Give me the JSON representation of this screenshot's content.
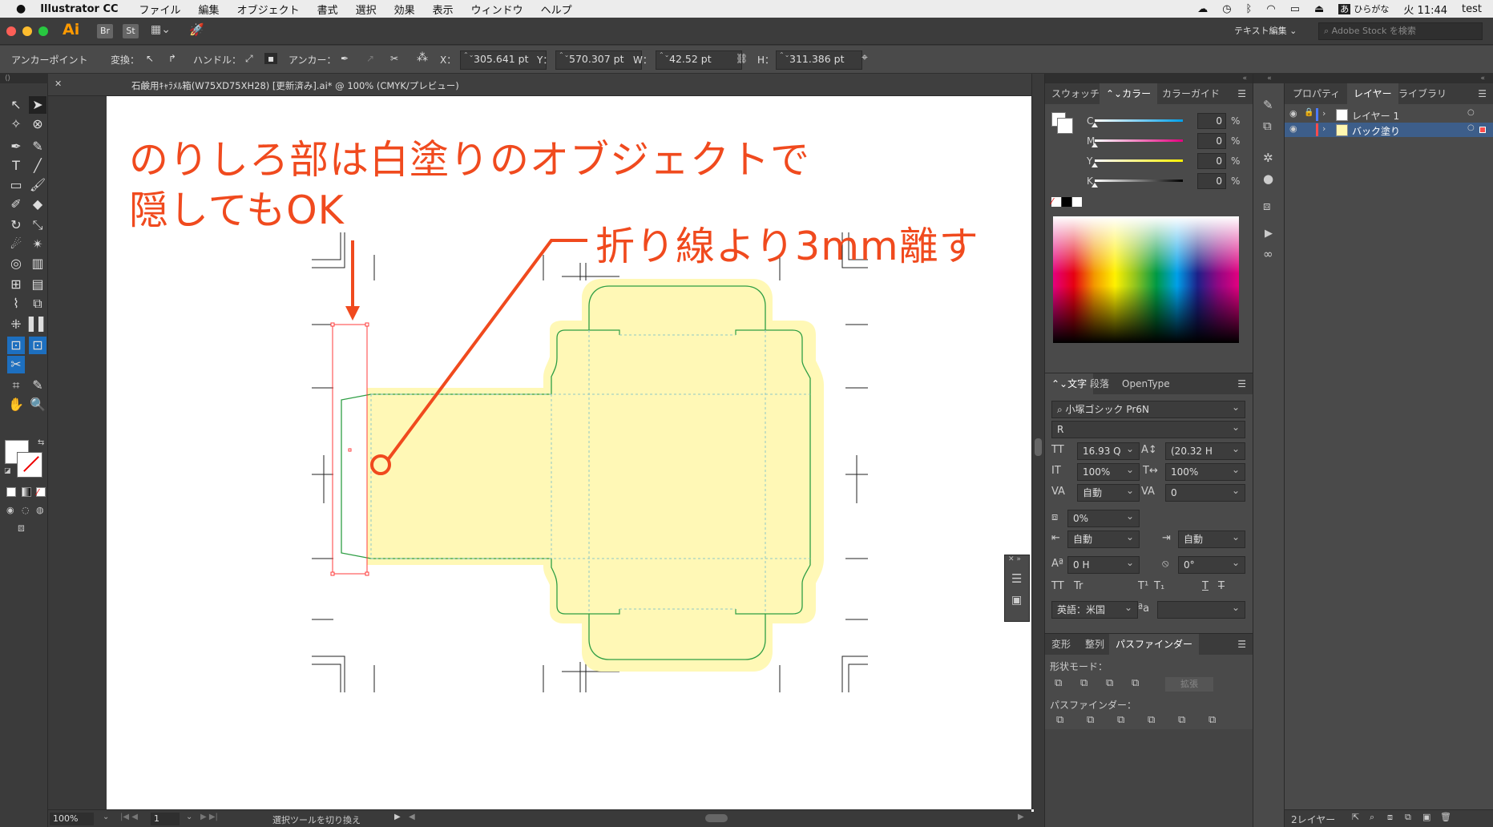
{
  "menubar": {
    "app": "Illustrator CC",
    "items": [
      "ファイル",
      "編集",
      "オブジェクト",
      "書式",
      "選択",
      "効果",
      "表示",
      "ウィンドウ",
      "ヘルプ"
    ],
    "input_source": "ひらがな",
    "clock": "火 11:44",
    "user": "test"
  },
  "appbar": {
    "logo": "Ai",
    "br": "Br",
    "st": "St",
    "workspace": "テキスト編集",
    "search_placeholder": "Adobe Stock を検索"
  },
  "controlbar": {
    "mode": "アンカーポイント",
    "convert": "変換：",
    "handle": "ハンドル：",
    "anchor": "アンカー：",
    "x_label": "X：",
    "x": "305.641 pt",
    "y_label": "Y：",
    "y": "570.307 pt",
    "w_label": "W：",
    "w": "42.52 pt",
    "h_label": "H：",
    "h": "311.386 pt"
  },
  "document": {
    "tab_title": "石鹸用ｷｬﾗﾒﾙ箱(W75XD75XH28) [更新済み].ai* @ 100% (CMYK/プレビュー)",
    "zoom": "100%",
    "page": "1",
    "status": "選択ツールを切り換え"
  },
  "annotations": {
    "line1": "のりしろ部は白塗りのオブジェクトで",
    "line2": "隠してもOK",
    "fold": "折り線より3mm離す"
  },
  "color_panel": {
    "tabs": [
      "スウォッチ",
      "カラー",
      "カラーガイド"
    ],
    "active_tab": 1,
    "channels": [
      {
        "name": "C",
        "value": "0",
        "unit": "%",
        "color": "#00a0e9"
      },
      {
        "name": "M",
        "value": "0",
        "unit": "%",
        "color": "#e4007f"
      },
      {
        "name": "Y",
        "value": "0",
        "unit": "%",
        "color": "#fff100"
      },
      {
        "name": "K",
        "value": "0",
        "unit": "%",
        "color": "#000000"
      }
    ]
  },
  "char_panel": {
    "tabs": [
      "文字",
      "段落",
      "OpenType"
    ],
    "font": "小塚ゴシック Pr6N",
    "style": "R",
    "size": "16.93 Q",
    "leading": "(20.32 H",
    "vscale": "100%",
    "hscale": "100%",
    "kerning": "自動",
    "tracking": "0",
    "tsume": "0%",
    "aki_before": "自動",
    "aki_after": "自動",
    "baseline": "0 H",
    "rotation": "0°",
    "language": "英語：米国"
  },
  "pathfinder_panel": {
    "tabs": [
      "変形",
      "整列",
      "パスファインダー"
    ],
    "shape_modes_label": "形状モード：",
    "expand": "拡張",
    "pathfinders_label": "パスファインダー："
  },
  "layers_panel": {
    "tabs": [
      "プロパティ",
      "レイヤー",
      "ライブラリ"
    ],
    "layers": [
      {
        "name": "レイヤー 1",
        "color": "#4b7bff",
        "thumb": "#ffffff"
      },
      {
        "name": "バック塗り",
        "color": "#ff4b4b",
        "thumb": "#fff7b0"
      }
    ],
    "footer": "2レイヤー"
  },
  "colors": {
    "annotation_red": "#f04a1e",
    "die_fill": "#fff8b6",
    "die_line": "#2e9e44",
    "selection_red": "#ff3b3b"
  }
}
